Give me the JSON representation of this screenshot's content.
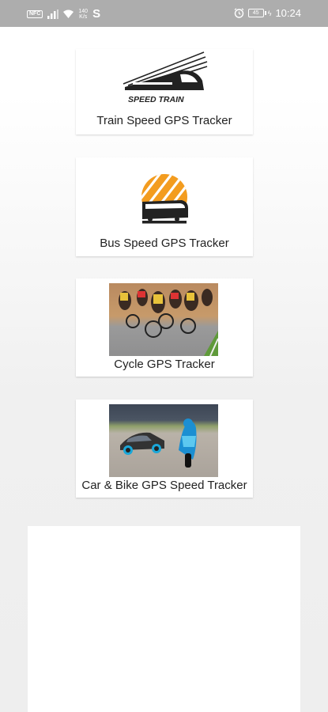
{
  "status_bar": {
    "nfc": "NFC",
    "speed_top": "140",
    "speed_bottom": "K/s",
    "s_icon": "S",
    "battery": "45",
    "time": "10:24"
  },
  "cards": [
    {
      "label": "Train Speed GPS Tracker",
      "logo_text": "SPEED TRAIN",
      "icon": "speed-train-logo"
    },
    {
      "label": "Bus Speed GPS Tracker",
      "icon": "bus-sunset-logo"
    },
    {
      "label": "Cycle GPS Tracker",
      "icon": "cyclists-race-photo"
    },
    {
      "label": "Car & Bike GPS Speed Tracker",
      "icon": "car-and-motorbike-photo"
    }
  ],
  "colors": {
    "status_bar": "#adadad",
    "bus_logo_orange": "#f39c1f"
  }
}
